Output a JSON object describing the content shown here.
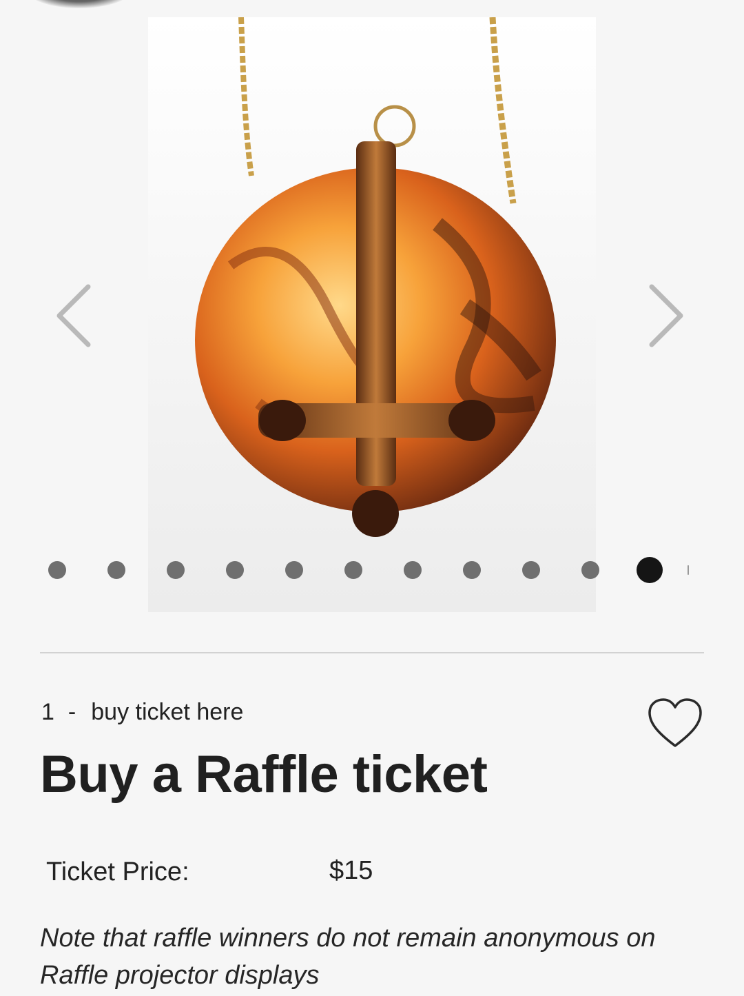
{
  "carousel": {
    "prev_icon": "chevron-left-icon",
    "next_icon": "chevron-right-icon",
    "image_subject": "round tortoiseshell pendant with gold chain",
    "dot_count": 11,
    "active_dot_index": 10
  },
  "listing": {
    "lot_number": "1",
    "separator": "-",
    "lot_link": "buy ticket here",
    "favorite_icon": "heart-icon",
    "title": "Buy a Raffle ticket",
    "price_label": "Ticket Price:",
    "price_value": "$15",
    "note": "Note that raffle winners do not remain anonymous on Raffle projector displays"
  },
  "colors": {
    "background": "#f6f6f6",
    "text": "#202020",
    "dot_inactive": "#6f6f6f",
    "dot_active": "#151515",
    "divider": "#d2d2d2"
  }
}
